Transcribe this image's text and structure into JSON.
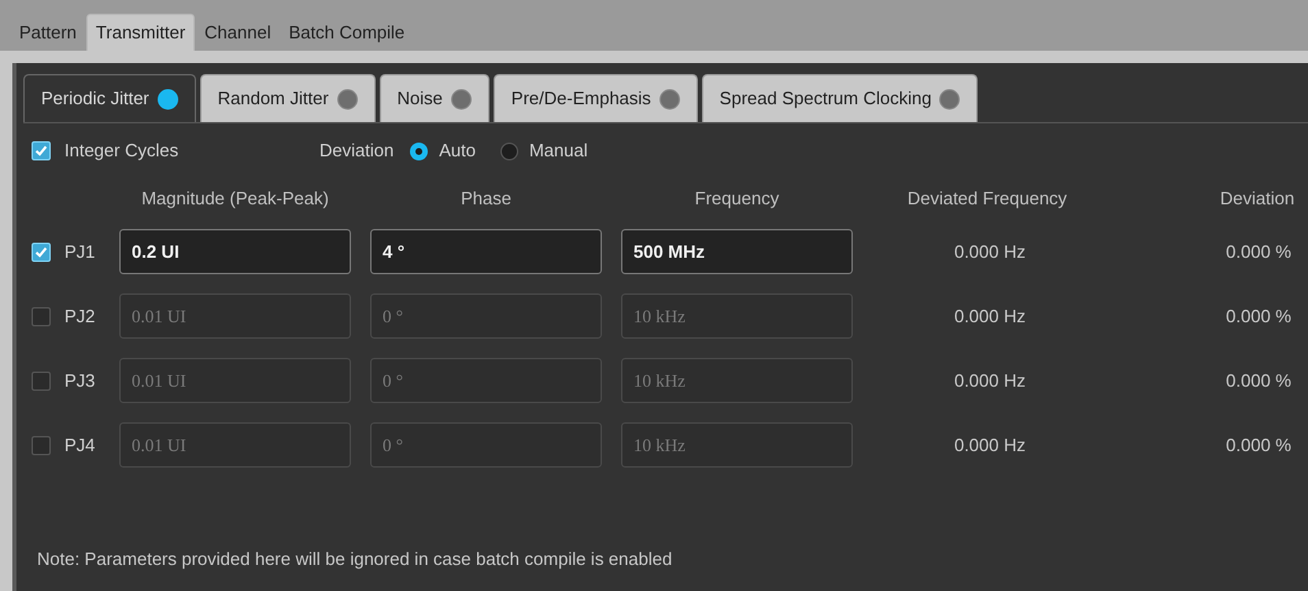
{
  "tabs": [
    {
      "label": "Pattern",
      "selected": false
    },
    {
      "label": "Transmitter",
      "selected": true
    },
    {
      "label": "Channel",
      "selected": false
    },
    {
      "label": "Batch Compile",
      "selected": false
    }
  ],
  "subtabs": [
    {
      "label": "Periodic Jitter",
      "selected": true,
      "on": true
    },
    {
      "label": "Random Jitter",
      "selected": false,
      "on": false
    },
    {
      "label": "Noise",
      "selected": false,
      "on": false
    },
    {
      "label": "Pre/De-Emphasis",
      "selected": false,
      "on": false
    },
    {
      "label": "Spread Spectrum Clocking",
      "selected": false,
      "on": false
    }
  ],
  "integer_cycles": {
    "label": "Integer Cycles",
    "checked": true
  },
  "deviation": {
    "label": "Deviation",
    "options": [
      {
        "label": "Auto",
        "selected": true
      },
      {
        "label": "Manual",
        "selected": false
      }
    ]
  },
  "table": {
    "columns": [
      "Magnitude (Peak-Peak)",
      "Phase",
      "Frequency",
      "Deviated Frequency",
      "Deviation"
    ],
    "rows": [
      {
        "name": "PJ1",
        "checked": true,
        "magnitude": "0.2 UI",
        "phase": "4 °",
        "frequency": "500 MHz",
        "deviated_frequency": "0.000 Hz",
        "deviation": "0.000 %"
      },
      {
        "name": "PJ2",
        "checked": false,
        "magnitude": "0.01 UI",
        "phase": "0 °",
        "frequency": "10 kHz",
        "deviated_frequency": "0.000 Hz",
        "deviation": "0.000 %"
      },
      {
        "name": "PJ3",
        "checked": false,
        "magnitude": "0.01 UI",
        "phase": "0 °",
        "frequency": "10 kHz",
        "deviated_frequency": "0.000 Hz",
        "deviation": "0.000 %"
      },
      {
        "name": "PJ4",
        "checked": false,
        "magnitude": "0.01 UI",
        "phase": "0 °",
        "frequency": "10 kHz",
        "deviated_frequency": "0.000 Hz",
        "deviation": "0.000 %"
      }
    ]
  },
  "note": "Note: Parameters provided here will be ignored in case batch compile is enabled"
}
